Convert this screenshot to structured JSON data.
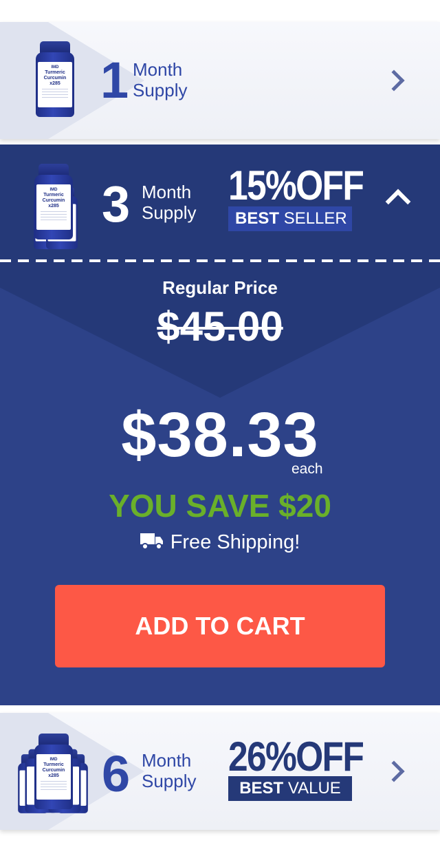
{
  "options": [
    {
      "quantity": "1",
      "unit_line1": "Month",
      "unit_line2": "Supply",
      "bottle_brand": "IMD",
      "bottle_name": "Turmeric Curcumin",
      "bottle_sub": "x285",
      "selected": false
    },
    {
      "quantity": "3",
      "unit_line1": "Month",
      "unit_line2": "Supply",
      "discount": "15%OFF",
      "badge_bold": "BEST",
      "badge_rest": "SELLER",
      "bottle_brand": "IMD",
      "bottle_name": "Turmeric Curcumin",
      "bottle_sub": "x285",
      "selected": true
    },
    {
      "quantity": "6",
      "unit_line1": "Month",
      "unit_line2": "Supply",
      "discount": "26%OFF",
      "badge_bold": "BEST",
      "badge_rest": "VALUE",
      "bottle_brand": "IMD",
      "bottle_name": "Turmeric Curcumin",
      "bottle_sub": "x285",
      "selected": false
    }
  ],
  "selected_detail": {
    "regular_price_label": "Regular Price",
    "regular_price": "$45.00",
    "price": "$38.33",
    "price_unit": "each",
    "savings": "YOU SAVE $20",
    "shipping": "Free Shipping!",
    "cta": "ADD TO CART"
  },
  "colors": {
    "navy": "#2d4288",
    "navy_dark": "#253978",
    "cta": "#fd5846",
    "savings_green": "#6ab02a",
    "number_blue": "#2f47a6"
  },
  "icons": {
    "collapsed_toggle": "chevron-right-icon",
    "expanded_toggle": "chevron-up-icon",
    "shipping": "truck-icon"
  }
}
